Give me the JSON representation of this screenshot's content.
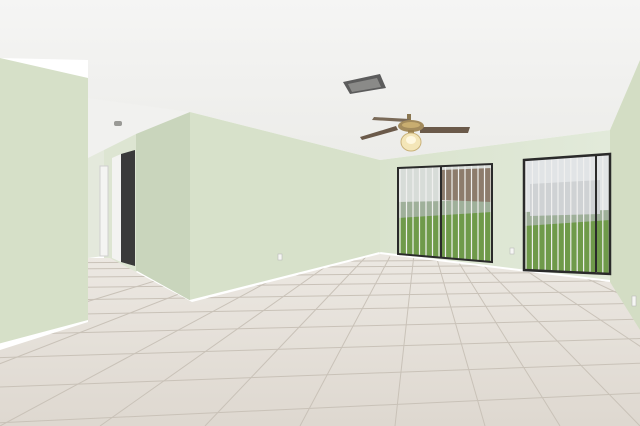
{
  "scene": {
    "subject": "empty-room-interior",
    "colors": {
      "ceiling": "#f3f3f2",
      "wall": "#d8e2cc",
      "wall_shadow": "#c8d4bb",
      "floor_tile": "#e2ddd6",
      "grout": "#c9c2b8",
      "baseboard": "#ffffff",
      "window_frame": "#2a2a2a",
      "greenery": "#6f9a4a",
      "fan_blade": "#6b5a4a",
      "fan_light": "#f4e6b8"
    },
    "objects": [
      {
        "name": "ceiling-fan",
        "icon": "ceiling-fan-icon"
      },
      {
        "name": "ceiling-vent",
        "icon": "vent-icon"
      },
      {
        "name": "window-left",
        "icon": "window-icon"
      },
      {
        "name": "window-right",
        "icon": "window-icon"
      },
      {
        "name": "hallway-door",
        "icon": "door-icon"
      },
      {
        "name": "tile-floor",
        "icon": "floor-icon"
      }
    ]
  }
}
